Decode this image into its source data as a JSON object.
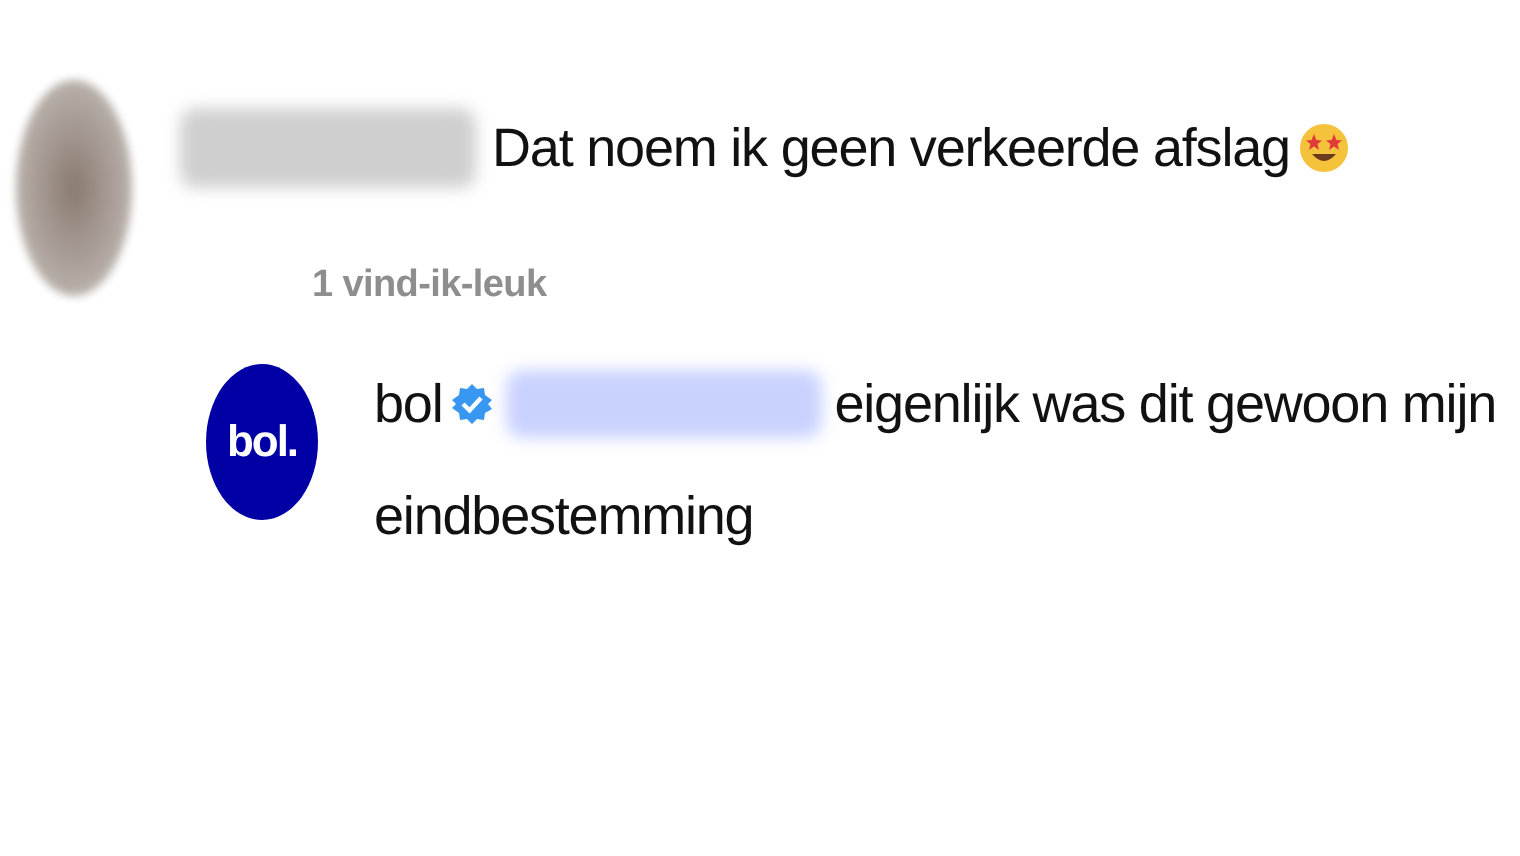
{
  "comment": {
    "text": "Dat noem ik geen verkeerde afslag",
    "likes": "1 vind-ik-leuk"
  },
  "reply": {
    "logo_text": "bol.",
    "author": "bol",
    "verified": true,
    "text_lines": [
      "eigenlijk was dit gewoon mijn",
      "eindbestemming"
    ]
  }
}
